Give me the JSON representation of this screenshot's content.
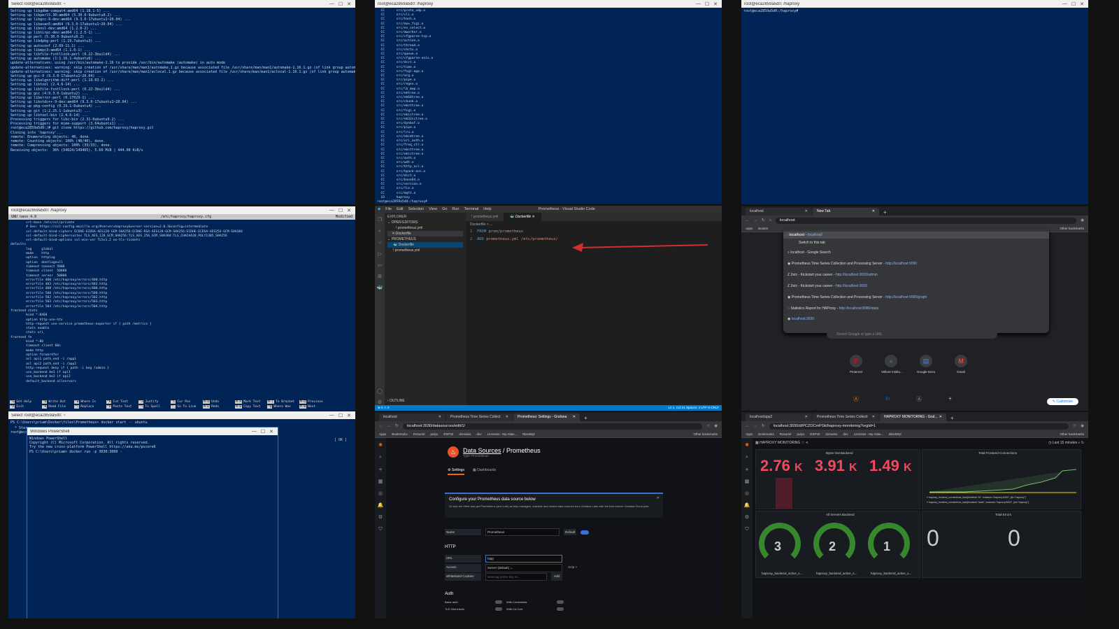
{
  "p1": {
    "title": "Select root@eca2859a5d0: ~",
    "lines": [
      "Setting up libgdbm-compat4:amd64 (1.18.1-5) ...",
      "Setting up libperl5.30:amd64 (5.30.0-9ubuntu0.2) ...",
      "Setting up libgcc-9-dev:amd64 (9.3.0-17ubuntu1~20.04) ...",
      "Setting up libasan5:amd64 (9.3.0-17ubuntu1~20.04) ...",
      "Setting up libnsl-dev:amd64 (1.2.0-2) ...",
      "Setting up libtirpc-dev:amd64 (1.2.5-1) ...",
      "Setting up perl (5.30.0-9ubuntu0.2) ...",
      "Setting up libdpkg-perl (1.19.7ubuntu3) ...",
      "Setting up autoconf (2.69-11.1) ...",
      "Setting up libmpc3:amd64 (1.1.0-1) ...",
      "Setting up libfile-fcntllock-perl (0.22-3build4) ...",
      "Setting up automake (1:1.16.1-4ubuntu6) ...",
      "update-alternatives: using /usr/bin/automake-1.16 to provide /usr/bin/automake (automake) in auto mode",
      "update-alternatives: warning: skip creation of /usr/share/man/man1/automake.1.gz because associated file /usr/share/man/man1/automake-1.16.1.gz (of link group automake) doesn't exist",
      "update-alternatives: warning: skip creation of /usr/share/man/man1/aclocal.1.gz because associated file /usr/share/man/man1/aclocal-1.16.1.gz (of link group automake) doesn't exist",
      "Setting up gcc-9 (9.3.0-17ubuntu1~20.04) ...",
      "Setting up libalgorithm-diff-perl (1.19.03-2) ...",
      "Setting up libtool (2.4.6-14) ...",
      "Setting up libfile-fcntllock-perl (0.22-3build4) ...",
      "Setting up gcc (4:9.3.0-1ubuntu2) ...",
      "Setting up liberror-perl (0.17029-1) ...",
      "Setting up libstdc++-9-dev:amd64 (9.3.0-17ubuntu1~20.04) ...",
      "Setting up pkg-config (0.29.1-0ubuntu4) ...",
      "Setting up git (1:2.25.1-1ubuntu3) ...",
      "Setting up libtool-bin (2.4.6-14) ...",
      "Processing triggers for libc-bin (2.31-0ubuntu9.2) ...",
      "Processing triggers for mime-support (3.64ubuntu1) ...",
      "root@eca2859a5d0:/# git clone https://github.com/haproxy/haproxy.git",
      "Cloning into 'haproxy'...",
      "remote: Enumerating objects: 40, done.",
      "remote: Counting objects: 100% (40/40), done.",
      "remote: Compressing objects: 100% (33/33), done.",
      "Receiving objects:  36% (54024/149465), 5.60 MiB | 444.00 KiB/s"
    ]
  },
  "p2": {
    "title": "root@eca2859a5d0: /haproxy",
    "lines": [
      "  CC      src/proto_udp.o",
      "  CC      src/cli.o",
      "  CC      src/hash.o",
      "  CC      src/mux_fcgi.o",
      "  CC      src/ev_select.o",
      "  CC      src/mworker.o",
      "  CC      src/cfgparse-tcp.o",
      "  CC      src/action.o",
      "  CC      src/thread.o",
      "  CC      src/shctx.o",
      "  CC      src/queue.o",
      "  CC      src/cfgparse-unix.o",
      "  CC      src/dict.o",
      "  CC      src/time.o",
      "  CC      src/fcgi-app.o",
      "  CC      src/arg.o",
      "  CC      src/pipe.o",
      "  CC      src/regex.o",
      "  CC      src/lb_map.o",
      "  CC      src/ebtree.o",
      "  CC      src/eb64tree.o",
      "  CC      src/chunk.o",
      "  CC      src/ebsttree.o",
      "  CC      src/fcgi.o",
      "  CC      src/ebistree.o",
      "  CC      src/eb32sctree.o",
      "  CC      src/dynbuf.o",
      "  CC      src/pipe.o",
      "  CC      src/lru.o",
      "  CC      src/ebimtree.o",
      "  CC      src/uri_auth.o",
      "  CC      src/freq_ctr.o",
      "  CC      src/ebsttree.o",
      "  CC      src/ebistree.o",
      "  CC      src/auth.o",
      "  CC      src/wdt.o",
      "  CC      src/http_acl.o",
      "  CC      src/hpack-enc.o",
      "  CC      src/dict.o",
      "  CC      src/base64.o",
      "  CC      src/version.o",
      "  CC      src/fix.o",
      "  CC      src/mqtt.o",
      "  LD      haproxy",
      "root@eca2859a5d0:/haproxy#"
    ]
  },
  "p3": {
    "title": "root@eca2859a5d0: /haproxy",
    "lines": [
      "root@eca2859a5d0:/haproxy#"
    ]
  },
  "p4": {
    "title": "root@eca2859a5d0: /haproxy",
    "nano_ver": "GNU nano 4.8",
    "nano_file": "/etc/haproxy/haproxy.cfg",
    "nano_mod": "Modified",
    "lines": [
      "        crt-base /etc/ssl/private",
      "",
      "        # See: https://ssl-config.mozilla.org/#server=haproxy&server-version=2.0.3&config=intermediate",
      "        ssl-default-bind-ciphers ECDHE-ECDSA-AES128-GCM-SHA256:ECDHE-RSA-AES128-GCM-SHA256:ECDHE-ECDSA-AES256-GCM-SHA384",
      "        ssl-default-bind-ciphersuites TLS_AES_128_GCM_SHA256:TLS_AES_256_GCM_SHA384:TLS_CHACHA20_POLY1305_SHA256",
      "        ssl-default-bind-options ssl-min-ver TLSv1.2 no-tls-tickets",
      "",
      "defaults",
      "        log     global",
      "        mode    http",
      "        option  httplog",
      "        option  dontlognull",
      "        timeout connect 5000",
      "        timeout client  50000",
      "        timeout server  50000",
      "        errorfile 400 /etc/haproxy/errors/400.http",
      "        errorfile 403 /etc/haproxy/errors/403.http",
      "        errorfile 408 /etc/haproxy/errors/408.http",
      "        errorfile 500 /etc/haproxy/errors/500.http",
      "        errorfile 502 /etc/haproxy/errors/502.http",
      "        errorfile 503 /etc/haproxy/errors/503.http",
      "        errorfile 504 /etc/haproxy/errors/504.http",
      "frontend stats",
      "        bind *:8404",
      "        option http-use-htx",
      "        http-request use-service prometheus-exporter if { path /metrics }",
      "        stats enable",
      "        stats uri_",
      "frontend fe",
      "        bind *:80",
      "        timeout client 60s",
      "        mode http",
      "        option forwardfor",
      "        acl api1 path_end -i /app1",
      "        acl api2 path_end -i /app2",
      "        http-request deny if { path -i beg /admin }",
      "        use_backend be1 if api1",
      "        use_backend be2 if api2",
      "        default_backend allservers"
    ],
    "keys": [
      [
        "^G",
        "Get Help"
      ],
      [
        "^O",
        "Write Out"
      ],
      [
        "^W",
        "Where Is"
      ],
      [
        "^K",
        "Cut Text"
      ],
      [
        "^J",
        "Justify"
      ],
      [
        "^C",
        "Cur Pos"
      ],
      [
        "M-U",
        "Undo"
      ],
      [
        "M-A",
        "Mark Text"
      ],
      [
        "M-]",
        "To Bracket"
      ],
      [
        "M-Q",
        "Previous"
      ],
      [
        "^X",
        "Exit"
      ],
      [
        "^R",
        "Read File"
      ],
      [
        "^\\",
        "Replace"
      ],
      [
        "^U",
        "Paste Text"
      ],
      [
        "^T",
        "To Spell"
      ],
      [
        "^_",
        "Go To Line"
      ],
      [
        "M-E",
        "Redo"
      ],
      [
        "M-6",
        "Copy Text"
      ],
      [
        "^Q",
        "Where Was"
      ],
      [
        "M-W",
        "Next"
      ]
    ]
  },
  "p5": {
    "title": "Prometheus - Visual Studio Code",
    "menu": [
      "File",
      "Edit",
      "Selection",
      "View",
      "Go",
      "Run",
      "Terminal",
      "Help"
    ],
    "explorer": "EXPLORER",
    "open_editors": "OPEN EDITORS",
    "oe1": "prometheus.yml",
    "oe2": "Dockerfile",
    "folder": "PROMETHEUS",
    "f1": "Dockerfile",
    "f2": "prometheus.yml",
    "outline": "OUTLINE",
    "tab1": "prometheus.yml",
    "tab2": "Dockerfile",
    "crumb": "Dockerfile > ...",
    "code1_kw": "FROM",
    "code1_val": "prom/prometheus",
    "code2_kw": "ADD",
    "code2_val": "prometheus.yml /etc/prometheus/",
    "status_left": "⊗ 0 ⚠ 0",
    "status_right": "Ln 1, Col 21   Spaces: 4   UTF-8   CRLF"
  },
  "p6": {
    "tab1": "localhost",
    "tab2": "New Tab",
    "url": "localhost",
    "apps": "Apps",
    "bookmarks": "Bookm",
    "other": "Other bookmarks",
    "sugg_top": "localhost",
    "sugg_top_url": "localhost/",
    "switch": "Switch to this tab",
    "search": "localhost - Google Search",
    "s1t": "Prometheus Time Series Collection and Processing Server",
    "s1u": "http://localhost:9090",
    "s2t": "Zeio - Kickstart your career",
    "s2u": "http://localhost:3000/admin",
    "s3t": "Zeio - Kickstart your career",
    "s3u": "http://localhost:3000",
    "s4t": "Prometheus Time Series Collection and Processing Server",
    "s4u": "http://localhost:9090/graph",
    "s5t": "Statistics Report for HAProxy",
    "s5u": "http://localhost:8080/stats",
    "s6t": "localhost:3030",
    "placeholder": "Search Google or type a URL",
    "sc1": "Pinterest",
    "sc2": "Vellore Institu...",
    "sc3": "Google Docs",
    "sc4": "Gmail",
    "customize": "Customize"
  },
  "p7": {
    "title": "Select root@eca2859a5d0: ~",
    "ps_title": "Windows PowerShell",
    "cmd_line": "PS C:\\Users\\priam\\Docker\\files\\Prometheus> docker start -- ubuntu",
    "lines": [
      "Windows PowerShell",
      "Copyright (C) Microsoft Corporation. All rights reserved.",
      "",
      "Try the new cross-platform PowerShell https://aka.ms/pscore6",
      "",
      "PS C:\\Users\\priam> docker run -p 3030:3000 -"
    ],
    "side": [
      "  * Star",
      "root@ecc",
      "[ OK ]"
    ]
  },
  "p8": {
    "tab1": "localhost",
    "tab2": "Prometheus Time Series Collect",
    "tab3": "Prometheus: Settings - Grafana",
    "url": "localhost:3030/datasources/edit/1/",
    "bm": [
      "Apps",
      "Bookmarks",
      "Rosumé",
      "pulyo",
      "ESP32",
      "domains",
      "dev",
      "Licenses - My Atlas...",
      "BlackByt"
    ],
    "other": "Other bookmarks",
    "crumb1": "Data Sources",
    "crumb2": "Prometheus",
    "sub": "Type: Prometheus",
    "tab_settings": "Settings",
    "tab_dash": "Dashboards",
    "alert_title": "Configure your Prometheus data source below",
    "alert_body": "Or skip the effort and get Prometheus (and Loki) as fully managed, scalable and hosted data sources from Grafana Labs with the free-forever Grafana Cloud plan.",
    "name_lbl": "Name",
    "name_val": "Prometheus",
    "default_lbl": "Default",
    "http": "HTTP",
    "url_lbl": "URL",
    "url_val": "http|",
    "access_lbl": "Access",
    "access_val": "Server (default)",
    "help": "Help >",
    "cookies_lbl": "Whitelisted Cookies",
    "cookies_ph": "New tag (enter key to...",
    "add": "Add",
    "auth": "Auth",
    "basic": "Basic auth",
    "creds": "With Credentials",
    "tls": "TLS Client Auth",
    "ca": "With CA Cert"
  },
  "p9": {
    "tab1": "localhost/app2",
    "tab2": "Prometheus Time Series Collecti",
    "tab3": "HAPROXY MONITORING - Graf...",
    "url": "localhost:3030/d/PCZOCmPGk/haproxy-monitoring?orgId=1",
    "bm": [
      "Apps",
      "Bookmarks",
      "Rosumé",
      "pulyo",
      "ESP32",
      "domains",
      "dev",
      "Licenses - My Atlas...",
      "BlackByt"
    ],
    "other": "Other bookmarks",
    "dash": "HAPROXY MONITORING",
    "range": "Last 15 minutes",
    "bytes_title": "Bytes Out Backend",
    "v1": "2.76",
    "v2": "3.91",
    "v3": "1.49",
    "unit": "K",
    "conn_title": "Total Frontend Connections",
    "legend1": "haproxy_frontend_connections_total{frontend=\"fe\", instance=\"haproxy:8404\", job=\"haproxy\"}",
    "legend2": "haproxy_frontend_connections_total{frontend=\"stats\", instance=\"haproxy:8404\", job=\"haproxy\"}",
    "servers_title": "All Servers Backend",
    "g1": "3",
    "g2": "2",
    "g3": "1",
    "gl": "haproxy_backend_active_s...",
    "errors_title": "Total Errors",
    "e1": "0",
    "e2": "0"
  }
}
